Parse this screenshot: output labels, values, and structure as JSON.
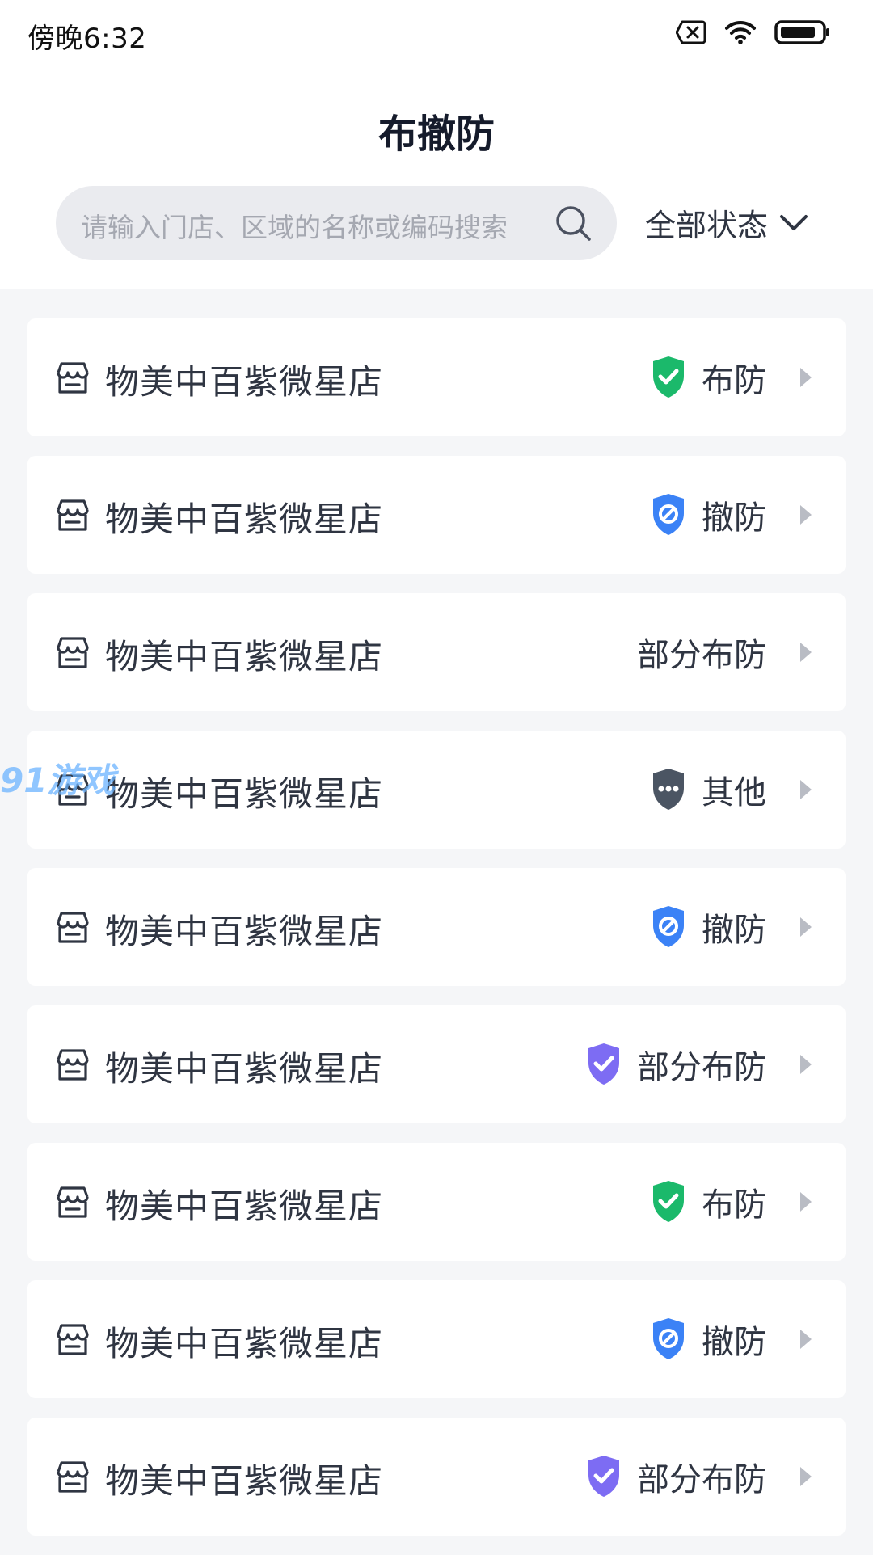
{
  "status_bar": {
    "time": "傍晚6:32"
  },
  "header": {
    "title": "布撤防"
  },
  "search": {
    "placeholder": "请输入门店、区域的名称或编码搜索"
  },
  "filter": {
    "label": "全部状态"
  },
  "stores": [
    {
      "name": "物美中百紫微星店",
      "status": "布防",
      "status_icon": "shield-check-green"
    },
    {
      "name": "物美中百紫微星店",
      "status": "撤防",
      "status_icon": "shield-ban-blue"
    },
    {
      "name": "物美中百紫微星店",
      "status": "部分布防",
      "status_icon": "none"
    },
    {
      "name": "物美中百紫微星店",
      "status": "其他",
      "status_icon": "shield-more-gray"
    },
    {
      "name": "物美中百紫微星店",
      "status": "撤防",
      "status_icon": "shield-ban-blue"
    },
    {
      "name": "物美中百紫微星店",
      "status": "部分布防",
      "status_icon": "shield-check-purple"
    },
    {
      "name": "物美中百紫微星店",
      "status": "布防",
      "status_icon": "shield-check-green"
    },
    {
      "name": "物美中百紫微星店",
      "status": "撤防",
      "status_icon": "shield-ban-blue"
    },
    {
      "name": "物美中百紫微星店",
      "status": "部分布防",
      "status_icon": "shield-check-purple"
    }
  ],
  "watermark": "91游戏",
  "colors": {
    "armed": "#1bb96b",
    "disarmed": "#3b82f6",
    "partial": "#7d6cf3",
    "other": "#4b5563",
    "background": "#f5f6f8",
    "card": "#ffffff"
  }
}
